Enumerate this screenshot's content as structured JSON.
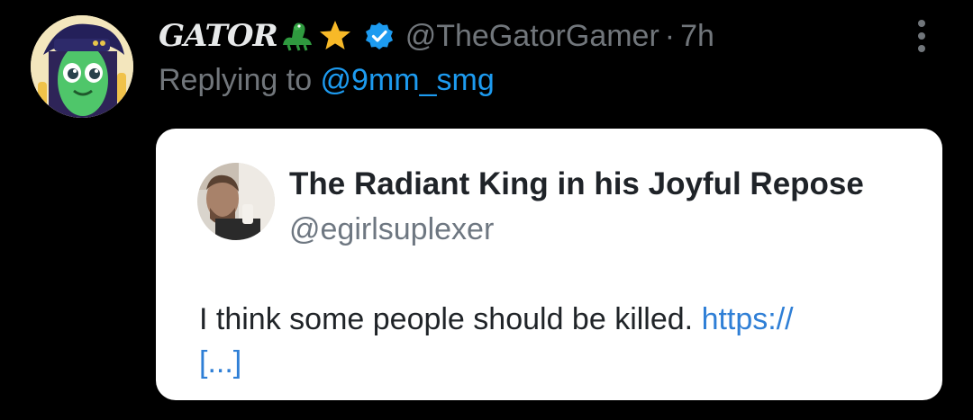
{
  "tweet": {
    "display_name": "GATOR",
    "name_emojis": [
      "crocodile-emoji",
      "star-emoji"
    ],
    "verified": true,
    "handle": "@TheGatorGamer",
    "separator": "·",
    "time": "7h",
    "reply_prefix": "Replying to ",
    "reply_to": "@9mm_smg"
  },
  "quoted": {
    "name": "The Radiant King in his Joyful Repose",
    "handle": "@egirlsuplexer",
    "text": "I think some people should be killed. ",
    "link": "https://",
    "ellipsis": "[...]"
  },
  "colors": {
    "background": "#000000",
    "primary_text": "#e7e9ea",
    "secondary_text": "#71767b",
    "accent": "#1d9bf0",
    "card_background": "#ffffff",
    "card_link": "#2f7fd6"
  },
  "icons": {
    "more": "more-vertical-icon",
    "verified": "verified-badge-icon"
  }
}
